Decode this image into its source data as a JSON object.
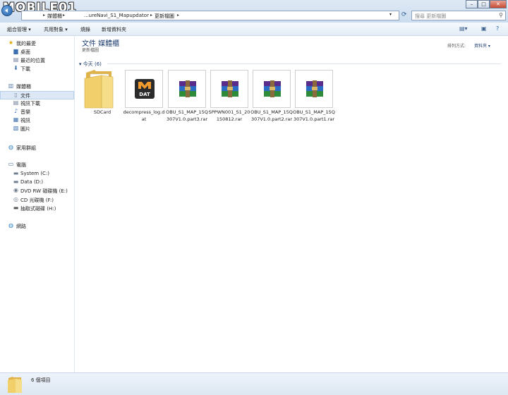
{
  "watermark": "MOBILE01",
  "address": {
    "crumbs": [
      "媒體櫃",
      "...ureNavi_S1_Mapupdator",
      "更新檔圖"
    ]
  },
  "search": {
    "placeholder": "搜尋 更新檔圖"
  },
  "window_controls": {
    "minimize": "–",
    "maximize": "□",
    "close": "✕"
  },
  "toolbar": {
    "organize": "組合管理 ▾",
    "share": "共用對象 ▾",
    "burn": "燒錄",
    "new_folder": "新增資料夾"
  },
  "nav": {
    "favorites": "我的最愛",
    "desktop": "桌面",
    "recent": "最近的位置",
    "downloads": "下載",
    "libraries": "媒體櫃",
    "documents": "文件",
    "videos": "視訊下載",
    "music": "音樂",
    "video": "視訊",
    "pictures": "圖片",
    "homegroup": "家用群組",
    "computer": "電腦",
    "drive_c": "System (C:)",
    "drive_d": "Data (D:)",
    "drive_e": "DVD RW 磁碟機 (E:)",
    "drive_f": "CD 光碟機 (F:)",
    "drive_h": "抽取式磁碟 (H:)",
    "network": "網路"
  },
  "library": {
    "title": "文件 媒體櫃",
    "subtitle": "更新檔圖",
    "arrange_label": "排列方式:",
    "arrange_value": "資料夾 ▾",
    "group_header": "今天 (6)"
  },
  "files": [
    {
      "name": "SDCard",
      "type": "folder"
    },
    {
      "name": "decompress_log.dat",
      "type": "dat",
      "badge": "DAT"
    },
    {
      "name": "OBU_S1_MAP_15Q307V1.0.part3.rar",
      "type": "rar"
    },
    {
      "name": "SPPWN001_S1_20150812.rar",
      "type": "rar"
    },
    {
      "name": "OBU_S1_MAP_15Q307V1.0.part2.rar",
      "type": "rar"
    },
    {
      "name": "OBU_S1_MAP_15Q307V1.0.part1.rar",
      "type": "rar"
    }
  ],
  "status": {
    "text": "6 個項目"
  },
  "colors": {
    "accent": "#1e3d6e",
    "rar_purple": "#5b2d8a",
    "rar_green": "#2e8b3a",
    "folder": "#f1cf6a"
  }
}
